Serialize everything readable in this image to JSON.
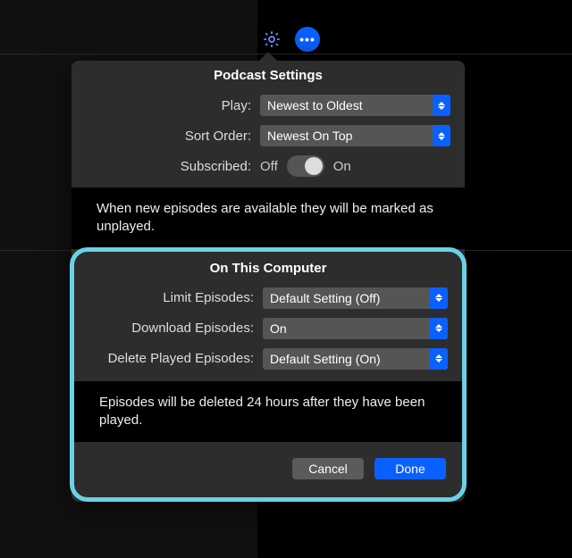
{
  "toolbar": {
    "gear_icon": "gear",
    "more_icon": "more"
  },
  "popover": {
    "title": "Podcast Settings",
    "play": {
      "label": "Play:",
      "value": "Newest to Oldest"
    },
    "sort": {
      "label": "Sort Order:",
      "value": "Newest On Top"
    },
    "subscribed": {
      "label": "Subscribed:",
      "off": "Off",
      "on": "On"
    },
    "note1": "When new episodes are available they will be marked as unplayed.",
    "section2": {
      "title": "On This Computer",
      "limit": {
        "label": "Limit Episodes:",
        "value": "Default Setting (Off)"
      },
      "download": {
        "label": "Download Episodes:",
        "value": "On"
      },
      "delete": {
        "label": "Delete Played Episodes:",
        "value": "Default Setting (On)"
      },
      "note": "Episodes will be deleted 24 hours after they have been played."
    },
    "buttons": {
      "cancel": "Cancel",
      "done": "Done"
    }
  }
}
